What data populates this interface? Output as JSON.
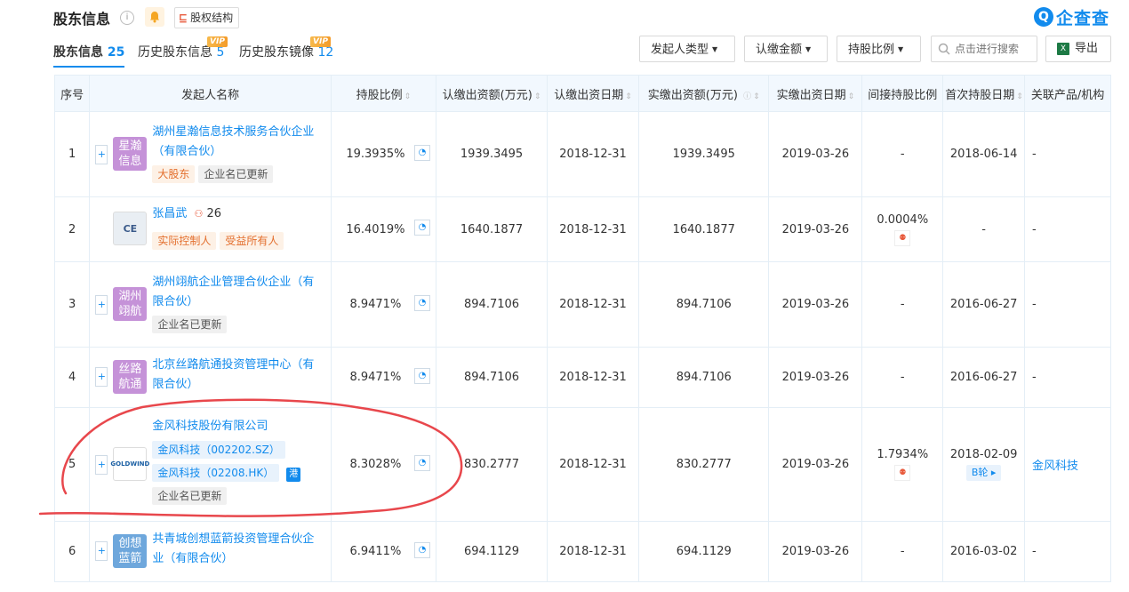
{
  "header": {
    "title": "股东信息",
    "equity_btn": "股权结构",
    "logo_text": "企查查"
  },
  "tabs": [
    {
      "label": "股东信息",
      "count": "25"
    },
    {
      "label": "历史股东信息",
      "count": "5",
      "badge": "VIP"
    },
    {
      "label": "历史股东镜像",
      "count": "12",
      "badge": "VIP"
    }
  ],
  "toolbar": {
    "type_filter": "发起人类型",
    "amount_filter": "认缴金额",
    "ratio_filter": "持股比例",
    "search_placeholder": "点击进行搜索",
    "export_label": "导出"
  },
  "table": {
    "headers": [
      "序号",
      "发起人名称",
      "持股比例",
      "认缴出资额(万元)",
      "认缴出资日期",
      "实缴出资额(万元)",
      "实缴出资日期",
      "间接持股比例",
      "首次持股日期",
      "关联产品/机构"
    ],
    "rows": [
      {
        "no": "1",
        "avatar": "星瀚信息",
        "name": "湖州星瀚信息技术服务合伙企业（有限合伙）",
        "tags": [
          "大股东",
          "企业名已更新"
        ],
        "ratio": "19.3935%",
        "sub_amount": "1939.3495",
        "sub_date": "2018-12-31",
        "paid_amount": "1939.3495",
        "paid_date": "2019-03-26",
        "indirect": "-",
        "first_date": "2018-06-14",
        "related": "-"
      },
      {
        "no": "2",
        "avatar": "CE",
        "name": "张昌武",
        "relation_count": "26",
        "tags": [
          "实际控制人",
          "受益所有人"
        ],
        "ratio": "16.4019%",
        "sub_amount": "1640.1877",
        "sub_date": "2018-12-31",
        "paid_amount": "1640.1877",
        "paid_date": "2019-03-26",
        "indirect": "0.0004%",
        "first_date": "-",
        "related": "-"
      },
      {
        "no": "3",
        "avatar": "湖州翊航",
        "name": "湖州翊航企业管理合伙企业（有限合伙）",
        "tags": [
          "企业名已更新"
        ],
        "ratio": "8.9471%",
        "sub_amount": "894.7106",
        "sub_date": "2018-12-31",
        "paid_amount": "894.7106",
        "paid_date": "2019-03-26",
        "indirect": "-",
        "first_date": "2016-06-27",
        "related": "-"
      },
      {
        "no": "4",
        "avatar": "丝路航通",
        "name": "北京丝路航通投资管理中心（有限合伙）",
        "tags": [],
        "ratio": "8.9471%",
        "sub_amount": "894.7106",
        "sub_date": "2018-12-31",
        "paid_amount": "894.7106",
        "paid_date": "2019-03-26",
        "indirect": "-",
        "first_date": "2016-06-27",
        "related": "-"
      },
      {
        "no": "5",
        "avatar": "GOLDWIND",
        "name": "金风科技股份有限公司",
        "stocks": [
          "金风科技（002202.SZ）",
          "金风科技（02208.HK）"
        ],
        "hk_badge": "港",
        "tags": [
          "企业名已更新"
        ],
        "ratio": "8.3028%",
        "sub_amount": "830.2777",
        "sub_date": "2018-12-31",
        "paid_amount": "830.2777",
        "paid_date": "2019-03-26",
        "indirect": "1.7934%",
        "first_date": "2018-02-09",
        "round": "B轮",
        "related": "金风科技"
      },
      {
        "no": "6",
        "avatar": "创想蓝箭",
        "name": "共青城创想蓝箭投资管理合伙企业（有限合伙）",
        "tags": [],
        "ratio": "6.9411%",
        "sub_amount": "694.1129",
        "sub_date": "2018-12-31",
        "paid_amount": "694.1129",
        "paid_date": "2019-03-26",
        "indirect": "-",
        "first_date": "2016-03-02",
        "related": "-"
      }
    ]
  },
  "colors": {
    "accent": "#128bed",
    "annotation": "#e8474c"
  }
}
